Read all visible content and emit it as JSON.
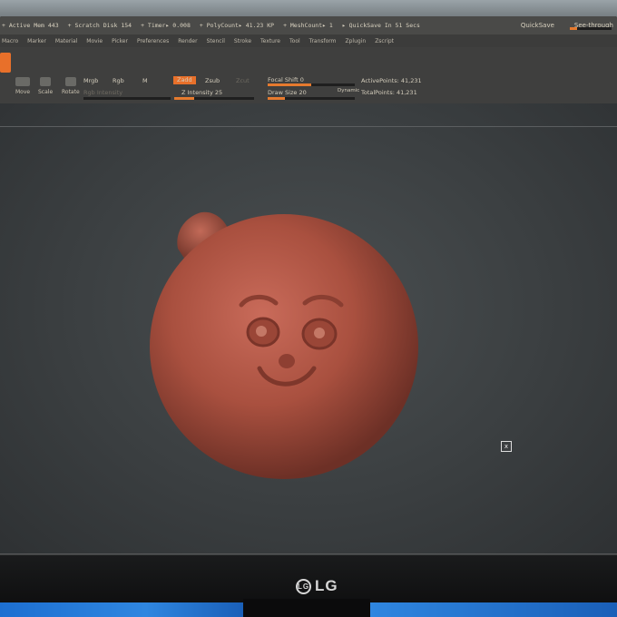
{
  "status": {
    "active_mem": "+ Active Mem 443",
    "scratch_disk": "+ Scratch Disk 154",
    "timer": "+ Timer▸ 0.008",
    "poly_count": "+ PolyCount▸ 41.23 KP",
    "mesh_count": "+ MeshCount▸ 1",
    "quicksave": "▸ QuickSave In 51 Secs",
    "quicksave_btn": "QuickSave",
    "see_through": "See-through"
  },
  "menu": [
    "Macro",
    "Marker",
    "Material",
    "Movie",
    "Picker",
    "Preferences",
    "Render",
    "Stencil",
    "Stroke",
    "Texture",
    "Tool",
    "Transform",
    "Zplugin",
    "Zscript"
  ],
  "shelf": {
    "move": "Move",
    "scale": "Scale",
    "rotate": "Rotate",
    "mrgb": "Mrgb",
    "rgb": "Rgb",
    "m": "M",
    "rgb_intensity": "Rgb Intensity",
    "zadd": "Zadd",
    "zsub": "Zsub",
    "zcut": "Zcut",
    "z_intensity": "Z Intensity 25",
    "focal_shift": "Focal Shift 0",
    "draw_size": "Draw Size 20",
    "dynamic": "Dynamic",
    "active_points": "ActivePoints: 41,231",
    "total_points": "TotalPoints: 41,231",
    "z_intensity_level": 0.25,
    "draw_size_level": 0.2
  },
  "brand": {
    "logo_text": "LG",
    "logo_mark": "LG"
  },
  "colors": {
    "accent": "#e8702a",
    "clay": "#b5594a",
    "desk": "#2f86e0"
  }
}
